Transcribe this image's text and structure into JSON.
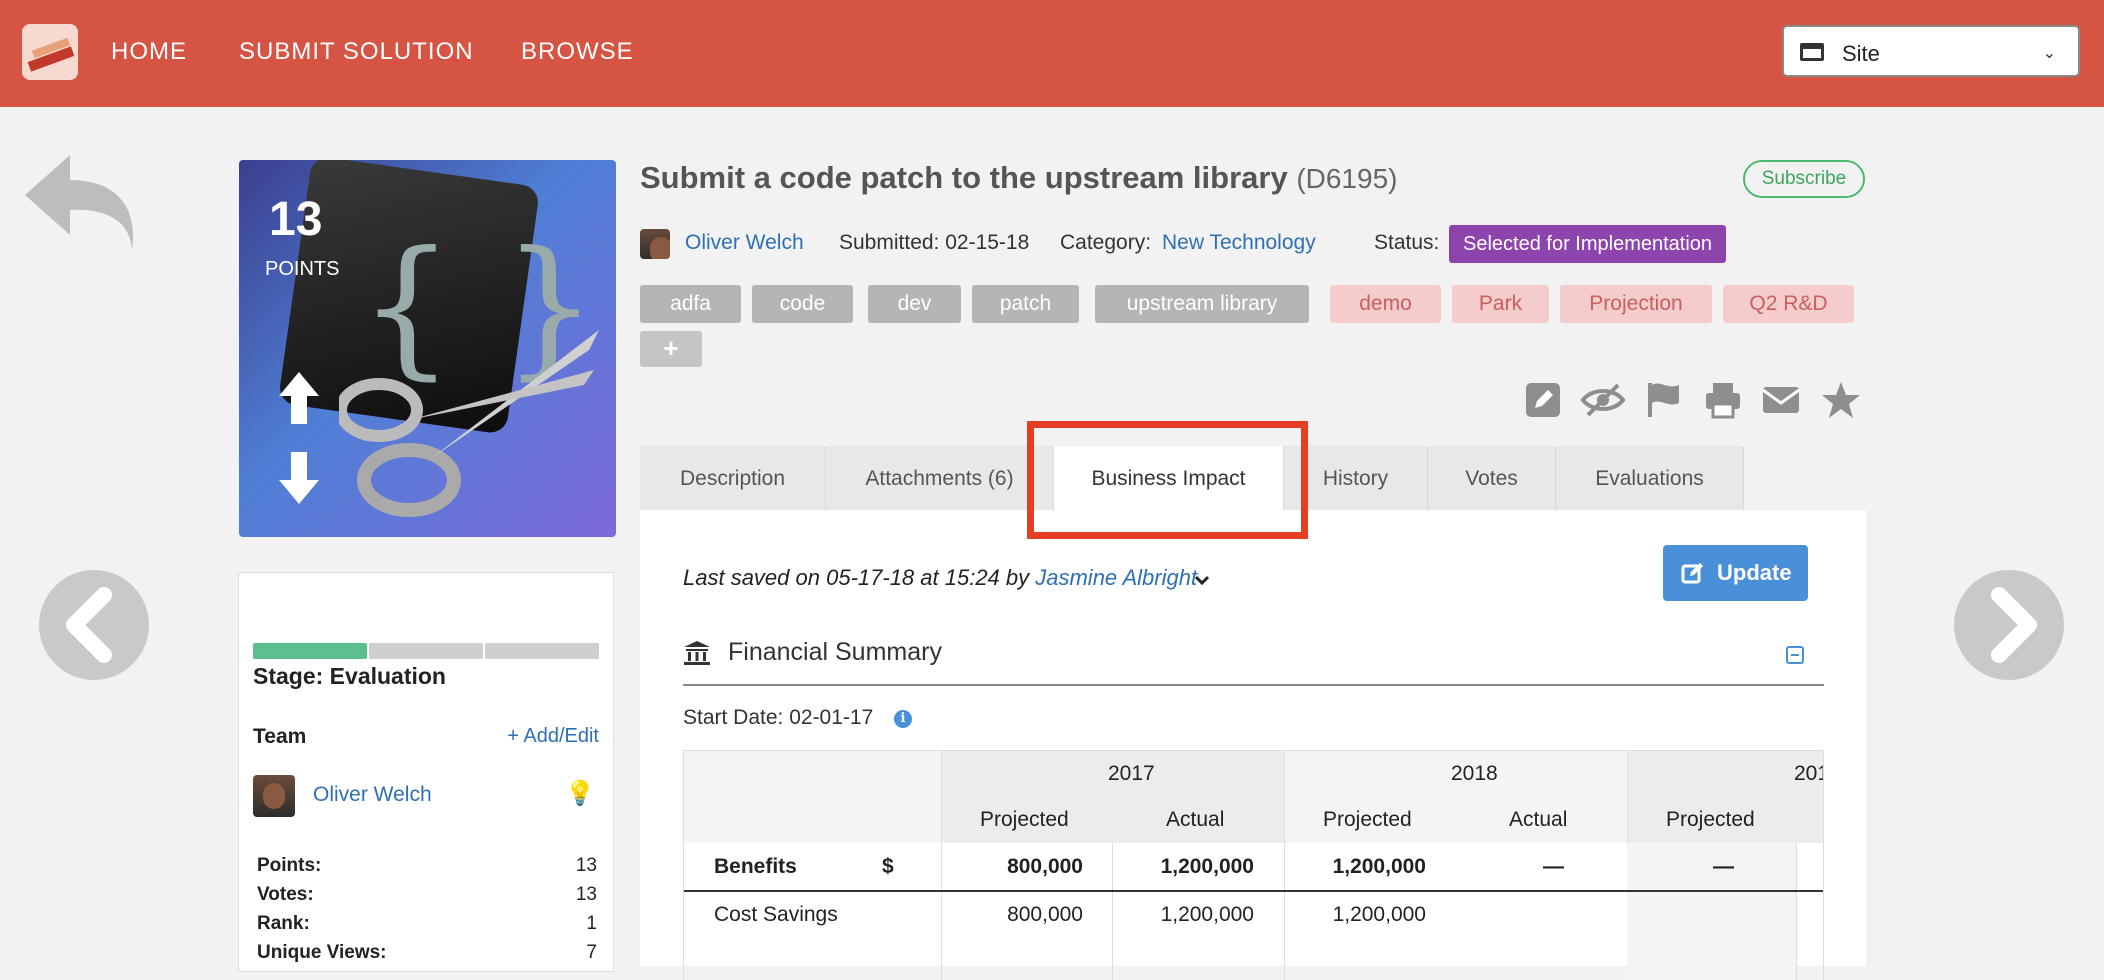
{
  "topbar": {
    "nav": [
      "HOME",
      "SUBMIT SOLUTION",
      "BROWSE"
    ],
    "site_select": "Site"
  },
  "idea": {
    "title": "Submit a code patch to the upstream library",
    "code": "(D6195)",
    "subscribe": "Subscribe",
    "points": "13",
    "points_label": "POINTS",
    "author": "Oliver Welch",
    "submitted": "Submitted: 02-15-18",
    "category_label": "Category:",
    "category": "New Technology",
    "status_label": "Status:",
    "status": "Selected for Implementation",
    "status_color": "#8e44ad",
    "tags_grey": [
      "adfa",
      "code",
      "dev",
      "patch",
      "upstream library"
    ],
    "tags_pink": [
      "demo",
      "Park",
      "Projection",
      "Q2 R&D"
    ],
    "tag_add": "+",
    "action_icons": [
      "edit-icon",
      "hide-icon",
      "flag-icon",
      "print-icon",
      "email-icon",
      "star-icon"
    ]
  },
  "tabs": [
    {
      "label": "Description"
    },
    {
      "label": "Attachments (6)"
    },
    {
      "label": "Business Impact",
      "active": true
    },
    {
      "label": "History"
    },
    {
      "label": "Votes"
    },
    {
      "label": "Evaluations"
    }
  ],
  "sidebar": {
    "stage": "Stage: Evaluation",
    "stage_progress": 0.333,
    "team_label": "Team",
    "add_edit": "+ Add/Edit",
    "member": "Oliver Welch",
    "stats": [
      {
        "k": "Points:",
        "v": "13"
      },
      {
        "k": "Votes:",
        "v": "13"
      },
      {
        "k": "Rank:",
        "v": "1"
      },
      {
        "k": "Unique Views:",
        "v": "7"
      }
    ]
  },
  "business_impact": {
    "saved_prefix": "Last saved on 05-17-18 at 15:24 by ",
    "saved_by": "Jasmine Albright",
    "update": "Update",
    "section_title": "Financial Summary",
    "start_date": "Start Date: 02-01-17",
    "info": "i",
    "years": [
      "2017",
      "2018",
      "201"
    ],
    "subheaders": [
      "Projected",
      "Actual",
      "Projected",
      "Actual",
      "Projected"
    ],
    "rows": [
      {
        "label": "Benefits",
        "unit": "$",
        "values": [
          "800,000",
          "1,200,000",
          "1,200,000",
          "—",
          "—"
        ]
      },
      {
        "label": "Cost Savings",
        "unit": "",
        "values": [
          "800,000",
          "1,200,000",
          "1,200,000",
          "",
          ""
        ]
      }
    ]
  }
}
